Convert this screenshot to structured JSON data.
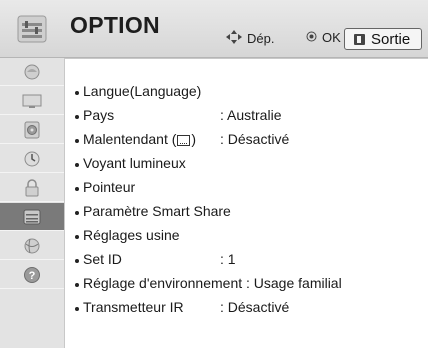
{
  "header": {
    "title": "OPTION",
    "move_hint": "Dép.",
    "ok_hint": "OK",
    "exit_label": "Sortie"
  },
  "sidebar": {
    "items": [
      {
        "icon": "picture-icon",
        "active": false
      },
      {
        "icon": "screen-icon",
        "active": false
      },
      {
        "icon": "audio-icon",
        "active": false
      },
      {
        "icon": "clock-icon",
        "active": false
      },
      {
        "icon": "lock-icon",
        "active": false
      },
      {
        "icon": "option-icon",
        "active": true
      },
      {
        "icon": "network-icon",
        "active": false
      },
      {
        "icon": "help-icon",
        "active": false
      }
    ]
  },
  "menu": {
    "items": [
      {
        "label": "Langue(Language)",
        "value": ""
      },
      {
        "label": "Pays",
        "value": ": Australie"
      },
      {
        "label": "Malentendant (",
        "label_suffix": ")",
        "value": ": Désactivé"
      },
      {
        "label": "Voyant lumineux",
        "value": ""
      },
      {
        "label": "Pointeur",
        "value": ""
      },
      {
        "label": "Paramètre Smart Share",
        "value": ""
      },
      {
        "label": "Réglages usine",
        "value": ""
      },
      {
        "label": "Set ID",
        "value": ": 1"
      },
      {
        "label": "Réglage d'environnement : Usage familial",
        "value": ""
      },
      {
        "label": "Transmetteur IR",
        "value": ": Désactivé"
      }
    ]
  },
  "colors": {
    "header_bg": "#dcdcdc",
    "sidebar_bg": "#e3e3e3",
    "active_bg": "#7a7a7a"
  }
}
